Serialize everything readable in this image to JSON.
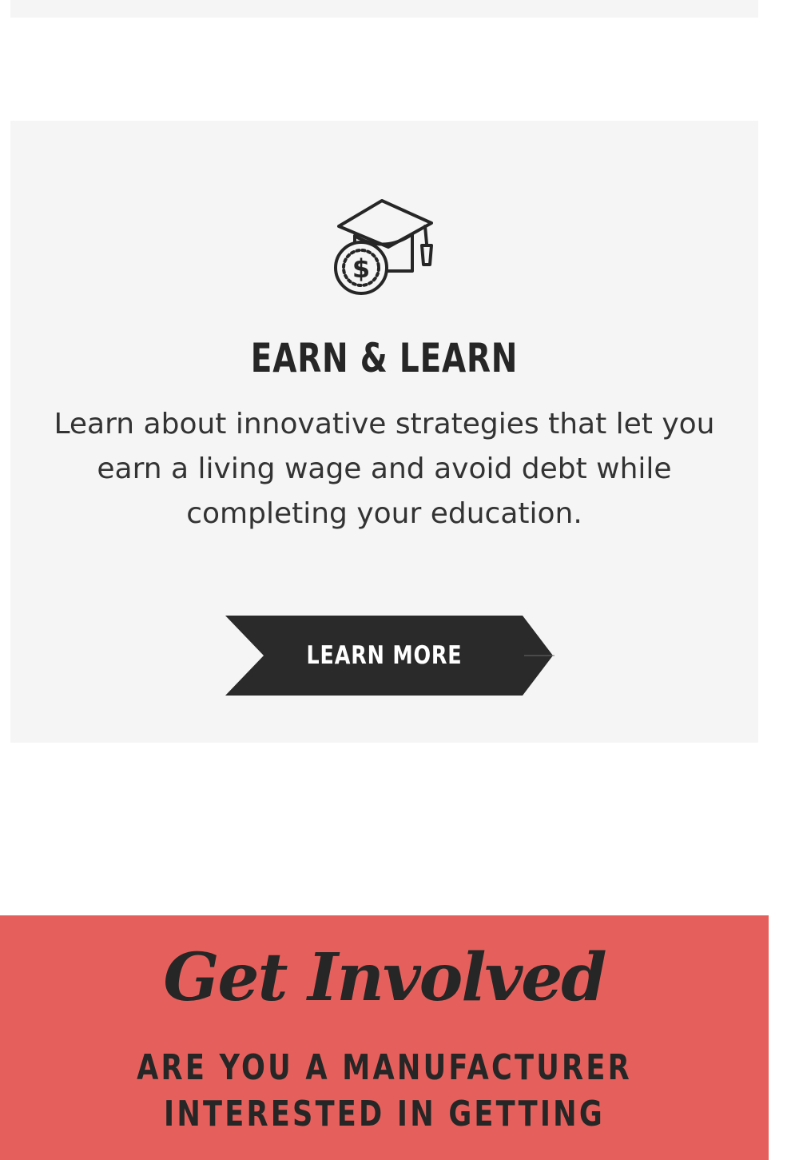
{
  "earn_learn": {
    "icon": "graduation-cap-dollar-icon",
    "title": "EARN & LEARN",
    "description": "Learn about innovative strategies that let you earn a living wage and avoid debt while completing your education.",
    "button_label": "LEARN MORE"
  },
  "get_involved": {
    "title": "Get Involved",
    "text": "ARE YOU A MANUFACTURER INTERESTED IN GETTING"
  },
  "colors": {
    "card_bg": "#f5f5f5",
    "button_bg": "#2a2a2a",
    "involved_bg": "#e5605c",
    "text_dark": "#262626"
  }
}
